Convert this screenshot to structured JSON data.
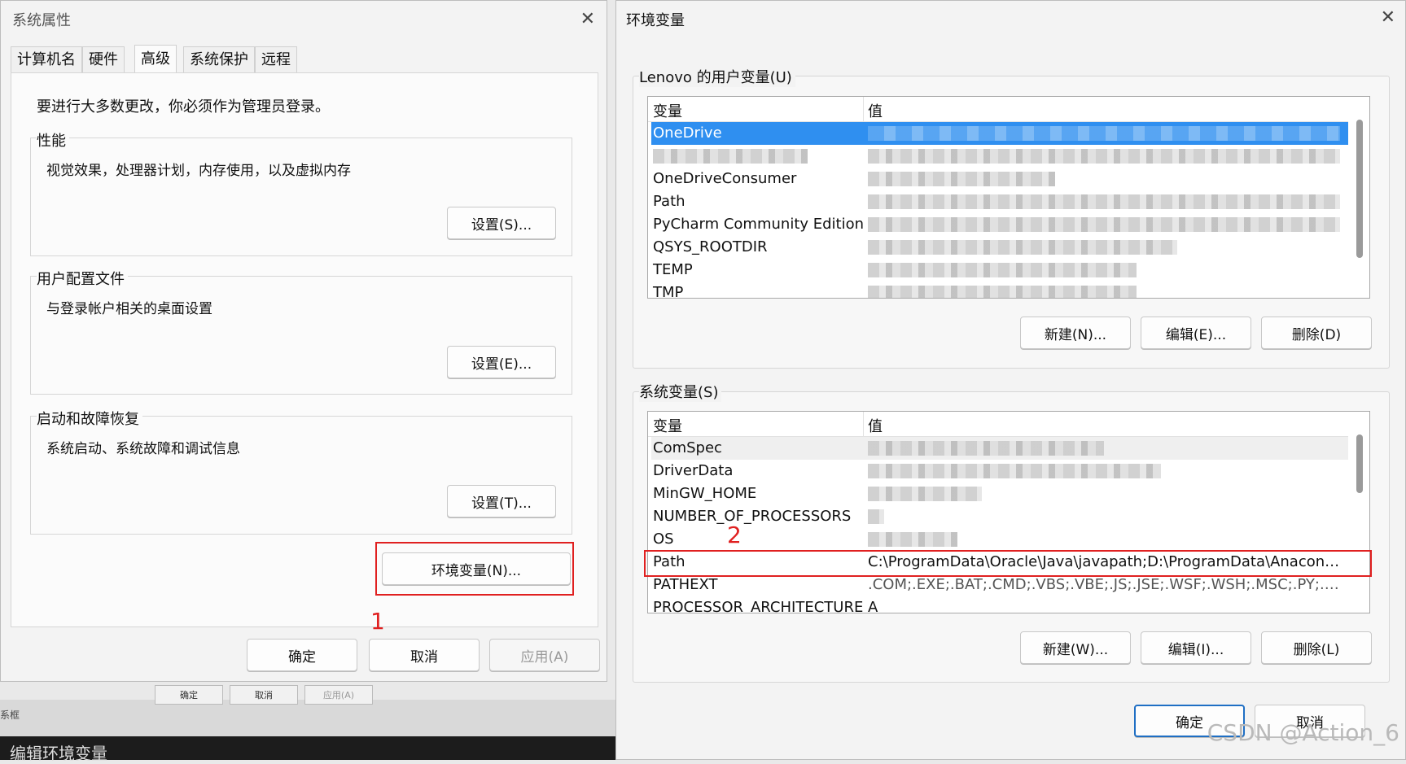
{
  "background": {
    "mini_ok": "确定",
    "mini_cancel": "取消",
    "mini_apply": "应用(A)",
    "mini_label": "系框",
    "taskbar_text": "编辑环境变量"
  },
  "sysprops": {
    "title": "系统属性",
    "tabs": [
      "计算机名",
      "硬件",
      "高级",
      "系统保护",
      "远程"
    ],
    "notice": "要进行大多数更改，你必须作为管理员登录。",
    "performance": {
      "title": "性能",
      "desc": "视觉效果，处理器计划，内存使用，以及虚拟内存",
      "button": "设置(S)..."
    },
    "profiles": {
      "title": "用户配置文件",
      "desc": "与登录帐户相关的桌面设置",
      "button": "设置(E)..."
    },
    "startup": {
      "title": "启动和故障恢复",
      "desc": "系统启动、系统故障和调试信息",
      "button": "设置(T)..."
    },
    "env_button": "环境变量(N)...",
    "annotation_1": "1",
    "ok": "确定",
    "cancel": "取消",
    "apply": "应用(A)"
  },
  "envvars": {
    "title": "环境变量",
    "user_section": "Lenovo 的用户变量(U)",
    "col_var": "变量",
    "col_val": "值",
    "user_rows": [
      {
        "name": "OneDrive",
        "value": ""
      },
      {
        "name": "",
        "value": ""
      },
      {
        "name": "OneDriveConsumer",
        "value": ""
      },
      {
        "name": "Path",
        "value": ""
      },
      {
        "name": "PyCharm Community Edition",
        "value": ""
      },
      {
        "name": "QSYS_ROOTDIR",
        "value": ""
      },
      {
        "name": "TEMP",
        "value": ""
      },
      {
        "name": "TMP",
        "value": ""
      }
    ],
    "user_new": "新建(N)...",
    "user_edit": "编辑(E)...",
    "user_delete": "删除(D)",
    "system_section": "系统变量(S)",
    "system_rows": [
      {
        "name": "ComSpec",
        "value": ""
      },
      {
        "name": "DriverData",
        "value": ""
      },
      {
        "name": "MinGW_HOME",
        "value": ""
      },
      {
        "name": "NUMBER_OF_PROCESSORS",
        "value": ""
      },
      {
        "name": "OS",
        "value": ""
      },
      {
        "name": "Path",
        "value": "C:\\ProgramData\\Oracle\\Java\\javapath;D:\\ProgramData\\Anaconda..."
      },
      {
        "name": "PATHEXT",
        "value": ".COM;.EXE;.BAT;.CMD;.VBS;.VBE;.JS;.JSE;.WSF;.WSH;.MSC;.PY;.PYW"
      },
      {
        "name": "PROCESSOR_ARCHITECTURE",
        "value": "A"
      }
    ],
    "annotation_2": "2",
    "sys_new": "新建(W)...",
    "sys_edit": "编辑(I)...",
    "sys_delete": "删除(L)",
    "ok": "确定",
    "cancel": "取消"
  },
  "watermark": "CSDN @Action_6",
  "colors": {
    "selection": "#2f8ff0",
    "annotation": "#e02020",
    "primary_border": "#1f6fc4"
  }
}
